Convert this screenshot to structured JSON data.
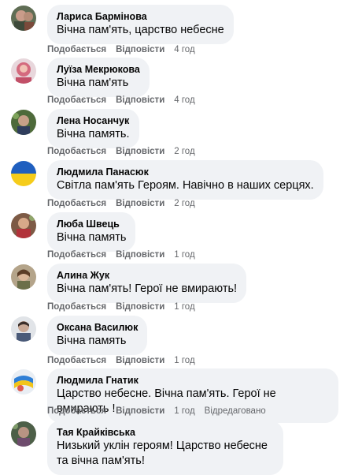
{
  "actions": {
    "like_label": "Подобається",
    "reply_label": "Відповісти"
  },
  "comments": [
    {
      "author": "Лариса Бармінова",
      "text": "Вічна пам'ять, царство небесне",
      "time": "4 год",
      "edited": ""
    },
    {
      "author": "Луїза Мекрюкова",
      "text": "Вічна пам'ять",
      "time": "4 год",
      "edited": ""
    },
    {
      "author": "Лена Носанчук",
      "text": "Вічна память.",
      "time": "2 год",
      "edited": ""
    },
    {
      "author": "Людмила Панасюк",
      "text": "Світла пам'ять Героям. Навічно в наших серцях.",
      "time": "2 год",
      "edited": ""
    },
    {
      "author": "Люба Швець",
      "text": "Вічна память",
      "time": "1 год",
      "edited": ""
    },
    {
      "author": "Алина Жук",
      "text": "Вічна пам'ять! Герої не вмирають!",
      "time": "1 год",
      "edited": ""
    },
    {
      "author": "Оксана Василюк",
      "text": "Вічна память",
      "time": "1 год",
      "edited": ""
    },
    {
      "author": "Людмила Гнатик",
      "text": "Царство небесне. Вічна пам'ять. Герої не вмирають !",
      "time": "1 год",
      "edited": "Відредаговано"
    },
    {
      "author": "Тая Крайківська",
      "text": "Низький уклін героям! Царство небесне та вічна пам'ять!",
      "time": "",
      "edited": ""
    }
  ]
}
